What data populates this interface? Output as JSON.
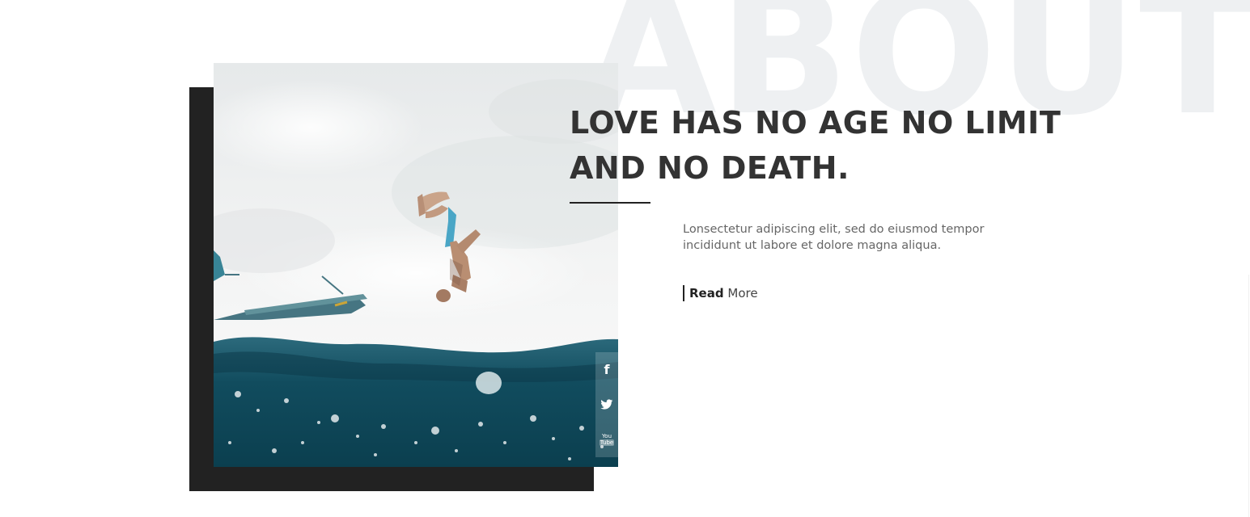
{
  "background_word": "ABOUT",
  "heading": {
    "line1": "LOVE HAS NO AGE NO LIMIT",
    "line2": "AND NO DEATH."
  },
  "description": {
    "line1": "Lonsectetur adipiscing elit, sed do eiusmod tempor",
    "line2": "incididunt ut labore et dolore magna aliqua."
  },
  "read_more": {
    "bold": "Read",
    "light": "More"
  },
  "social": [
    {
      "icon": "facebook-icon",
      "glyph": "f"
    },
    {
      "icon": "twitter-icon"
    },
    {
      "icon": "youtube-icon",
      "top": "You",
      "bottom": "Tube"
    }
  ],
  "colors": {
    "dark_block": "#222222",
    "heading": "#333333",
    "text": "#666666",
    "bg_word": "#eef0f2",
    "water": "#0f4a5c"
  }
}
